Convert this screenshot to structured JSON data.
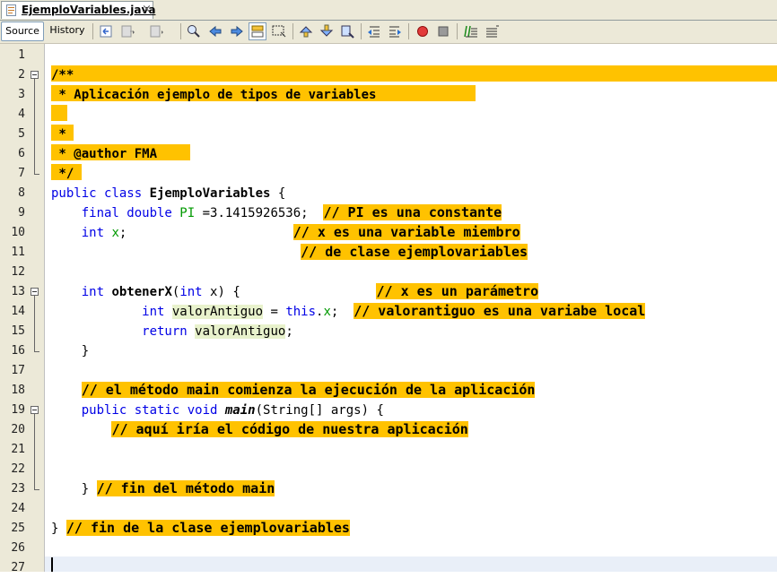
{
  "tab": {
    "title": "EjemploVariables.java",
    "close": "×"
  },
  "toolbar": {
    "source_label": "Source",
    "history_label": "History",
    "icons": [
      "back-icon",
      "nav-back-icon",
      "nav-forward-icon",
      "find-icon",
      "find-previous-icon",
      "find-next-icon",
      "toggle-highlight-icon",
      "rectangle-select-icon",
      "prev-bookmark-icon",
      "next-bookmark-icon",
      "toggle-bookmark-icon",
      "shift-left-icon",
      "shift-right-icon",
      "start-macro-icon",
      "stop-macro-icon",
      "comment-icon",
      "uncomment-icon"
    ]
  },
  "lines": [
    "1",
    "2",
    "3",
    "4",
    "5",
    "6",
    "7",
    "8",
    "9",
    "10",
    "11",
    "12",
    "13",
    "14",
    "15",
    "16",
    "17",
    "18",
    "19",
    "20",
    "21",
    "22",
    "23",
    "24",
    "25",
    "26",
    "27"
  ],
  "code": {
    "l2": "/**",
    "l3": " * Aplicación ejemplo de tipos de variables",
    "l5": " *",
    "l6_star": " * ",
    "l6_author": "@author FMA",
    "l7": " */",
    "l8_kw": "public class ",
    "l8_name": "EjemploVariables",
    "l8_rest": " {",
    "l9_kw": "    final double ",
    "l9_field": "PI",
    "l9_rest": " =3.1415926536;  ",
    "l9_comment": "// PI es una constante",
    "l10_kw": "    int ",
    "l10_field": "x",
    "l10_rest": ";                      ",
    "l10_comment": "// x es una variable miembro",
    "l11_pad": "                                 ",
    "l11_comment": "// de clase ejemplovariables",
    "l13_kw": "    int ",
    "l13_name": "obtenerX",
    "l13_p1": "(",
    "l13_kw2": "int",
    "l13_rest": " x) {                  ",
    "l13_comment": "// x es un parámetro",
    "l14_kw": "            int ",
    "l14_var": "valorAntiguo",
    "l14_mid": " = ",
    "l14_kw2": "this",
    "l14_dot": ".",
    "l14_field": "x",
    "l14_end": ";  ",
    "l14_comment": "// valorantiguo es una variabe local",
    "l15_kw": "            return ",
    "l15_var": "valorAntiguo",
    "l15_end": ";",
    "l16": "    }",
    "l18_pad": "    ",
    "l18_comment": "// el método main comienza la ejecución de la aplicación",
    "l19_kw": "    public static void ",
    "l19_name": "main",
    "l19_rest": "(String[] args) {",
    "l20_pad": "        ",
    "l20_comment": "// aquí iría el código de nuestra aplicación",
    "l23_brace": "    } ",
    "l23_comment": "// fin del método main",
    "l25_brace": "} ",
    "l25_comment": "// fin de la clase ejemplovariables"
  },
  "colors": {
    "comment_highlight": "#ffc200",
    "keyword": "#0000e6",
    "field": "#009900",
    "gutter": "#ece9d8"
  }
}
